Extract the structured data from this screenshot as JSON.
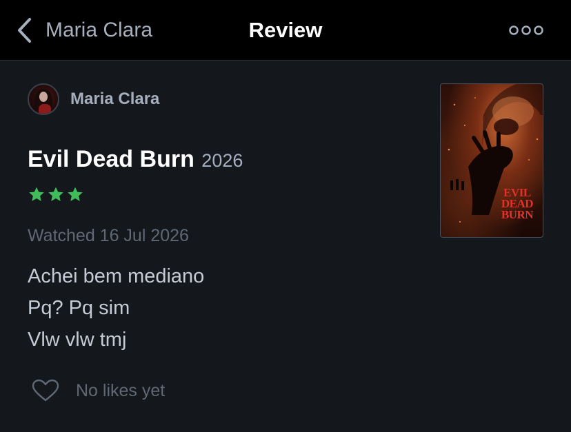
{
  "nav": {
    "back_label": "Maria Clara",
    "title": "Review",
    "more_icon": "more-horizontal-icon",
    "back_icon": "chevron-left-icon"
  },
  "review": {
    "author": "Maria Clara",
    "film_title": "Evil Dead Burn",
    "film_year": "2026",
    "rating_stars": 3,
    "rating_max": 5,
    "watched": "Watched 16 Jul 2026",
    "body_lines": [
      "Achei bem mediano",
      "Pq? Pq sim",
      "Vlw vlw tmj"
    ],
    "likes_label": "No likes yet",
    "poster_title_lines": [
      "EVIL",
      "DEAD",
      "BURN"
    ]
  },
  "colors": {
    "nav_background": "#000000",
    "page_background": "#14181d",
    "star_color": "#40bc5a",
    "muted_text": "#a6afbd",
    "dim_text": "#5f6874",
    "poster_title_color": "#e0312a"
  }
}
